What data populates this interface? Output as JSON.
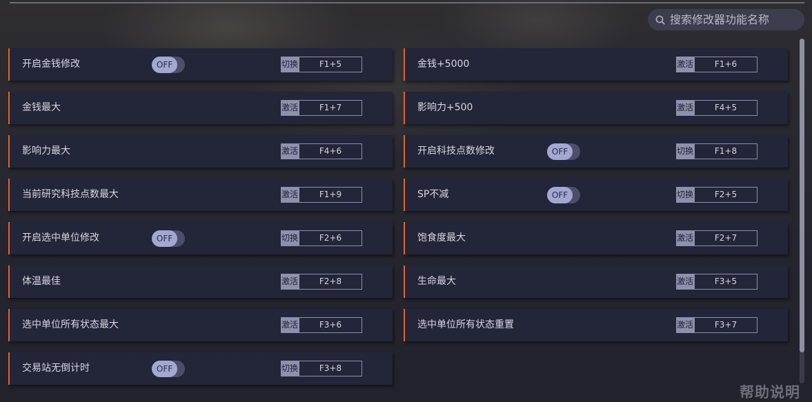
{
  "search": {
    "placeholder": "搜索修改器功能名称"
  },
  "cheats": [
    {
      "label": "开启金钱修改",
      "toggle": "OFF",
      "action": "切换",
      "key": "F1+5"
    },
    {
      "label": "金钱+5000",
      "action": "激活",
      "key": "F1+6"
    },
    {
      "label": "金钱最大",
      "action": "激活",
      "key": "F1+7"
    },
    {
      "label": "影响力+500",
      "action": "激活",
      "key": "F4+5"
    },
    {
      "label": "影响力最大",
      "action": "激活",
      "key": "F4+6"
    },
    {
      "label": "开启科技点数修改",
      "toggle": "OFF",
      "action": "切换",
      "key": "F1+8"
    },
    {
      "label": "当前研究科技点数最大",
      "action": "激活",
      "key": "F1+9"
    },
    {
      "label": "SP不减",
      "toggle": "OFF",
      "action": "切换",
      "key": "F2+5"
    },
    {
      "label": "开启选中单位修改",
      "toggle": "OFF",
      "action": "切换",
      "key": "F2+6"
    },
    {
      "label": "饱食度最大",
      "action": "激活",
      "key": "F2+7"
    },
    {
      "label": "体温最佳",
      "action": "激活",
      "key": "F2+8"
    },
    {
      "label": "生命最大",
      "action": "激活",
      "key": "F3+5"
    },
    {
      "label": "选中单位所有状态最大",
      "action": "激活",
      "key": "F3+6"
    },
    {
      "label": "选中单位所有状态重置",
      "action": "激活",
      "key": "F3+7"
    },
    {
      "label": "交易站无倒计时",
      "toggle": "OFF",
      "action": "切换",
      "key": "F3+8"
    }
  ],
  "help": {
    "label": "帮助说明"
  },
  "colors": {
    "accent": "#e0662a",
    "card": "#232538",
    "toggle_knob": "#a4a7d2"
  },
  "icons": {
    "search": "search-icon"
  }
}
